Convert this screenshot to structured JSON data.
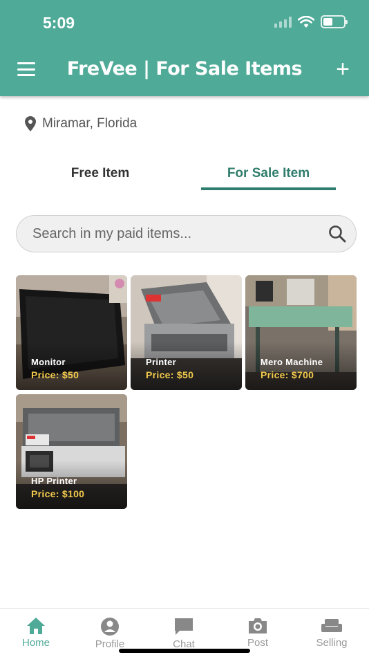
{
  "status_bar": {
    "time": "5:09"
  },
  "header": {
    "title": "FreVee | For Sale Items",
    "add_label": "+"
  },
  "location": {
    "icon": "map-pin-icon",
    "text": "Miramar, Florida"
  },
  "tabs": [
    {
      "label": "Free Item",
      "active": false
    },
    {
      "label": "For Sale Item",
      "active": true
    }
  ],
  "search": {
    "placeholder": "Search in my paid items...",
    "value": ""
  },
  "items": [
    {
      "name": "Monitor",
      "price": "Price: $50"
    },
    {
      "name": "Printer",
      "price": "Price: $50"
    },
    {
      "name": "Mero Machine",
      "price": "Price: $700"
    },
    {
      "name": "HP Printer",
      "price": "Price: $100"
    }
  ],
  "bottom_nav": [
    {
      "label": "Home",
      "icon": "home-icon",
      "active": true
    },
    {
      "label": "Profile",
      "icon": "profile-icon",
      "active": false
    },
    {
      "label": "Chat",
      "icon": "chat-icon",
      "active": false
    },
    {
      "label": "Post",
      "icon": "camera-icon",
      "active": false
    },
    {
      "label": "Selling",
      "icon": "sofa-icon",
      "active": false
    }
  ],
  "colors": {
    "brand": "#4faa98",
    "tab_active": "#2f7d6c",
    "price": "#f2c94c"
  }
}
